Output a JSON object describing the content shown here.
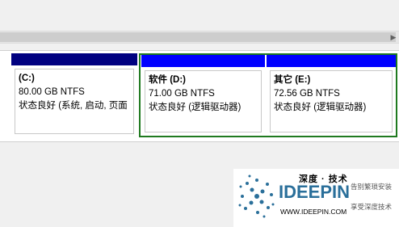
{
  "partitions": [
    {
      "name": "(C:)",
      "size": "80.00 GB NTFS",
      "status": "状态良好 (系统, 启动, 页面",
      "header_color": "#000080"
    },
    {
      "name": "软件  (D:)",
      "size": "71.00 GB NTFS",
      "status": "状态良好 (逻辑驱动器)",
      "header_color": "#0000ff"
    },
    {
      "name": "其它  (E:)",
      "size": "72.56 GB NTFS",
      "status": "状态良好 (逻辑驱动器)",
      "header_color": "#0000ff"
    }
  ],
  "watermark": {
    "title": "深度 · 技术",
    "wordmark": "IDEEPIN",
    "url": "WWW.IDEEPIN.COM",
    "slogan_1": "告别繁琐安装",
    "slogan_2": "享受深度技术"
  },
  "scrollbar": {
    "arrow": "▶"
  },
  "colors": {
    "selection_border": "#1f7a1f",
    "primary_header": "#000080",
    "logical_header": "#0000ff",
    "logo_blue": "#2a6f9a"
  },
  "icons": {
    "logo": "ideepin-swirl-logo"
  }
}
